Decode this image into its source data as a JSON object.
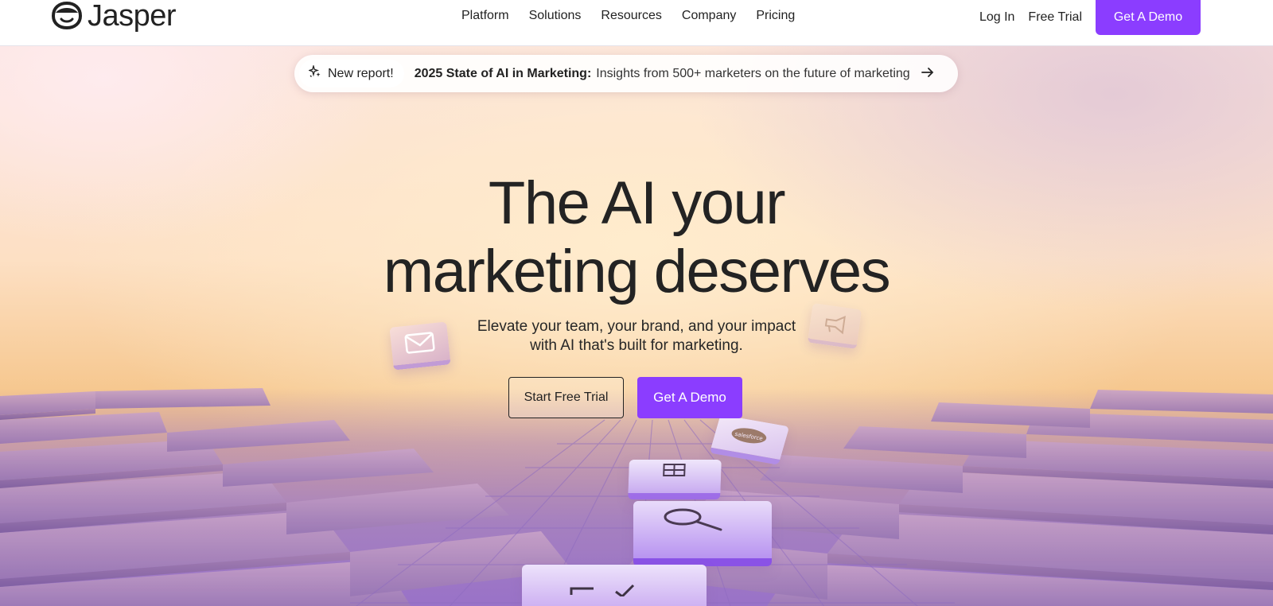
{
  "nav": {
    "logo_text": "Jasper",
    "links": [
      {
        "label": "Platform"
      },
      {
        "label": "Solutions"
      },
      {
        "label": "Resources"
      },
      {
        "label": "Company"
      },
      {
        "label": "Pricing"
      }
    ],
    "login_label": "Log In",
    "free_trial_label": "Free Trial",
    "demo_label": "Get A Demo"
  },
  "banner": {
    "pill_icon": "sparkle-icon",
    "pill_label": "New report!",
    "strong_text": "2025 State of AI in Marketing:",
    "text": "Insights from 500+ marketers on the future of marketing",
    "arrow_icon": "arrow-right-icon"
  },
  "hero": {
    "headline_line1": "The AI your",
    "headline_line2": "marketing deserves",
    "sub_line1": "Elevate your team, your brand, and your impact",
    "sub_line2": "with AI that's built for marketing.",
    "start_trial_label": "Start Free Trial",
    "demo_label": "Get A Demo"
  },
  "colors": {
    "accent": "#8b3dff",
    "text": "#232323"
  },
  "decor_icons": [
    "mail-icon",
    "megaphone-icon",
    "salesforce-icon",
    "table-icon",
    "search-icon"
  ]
}
